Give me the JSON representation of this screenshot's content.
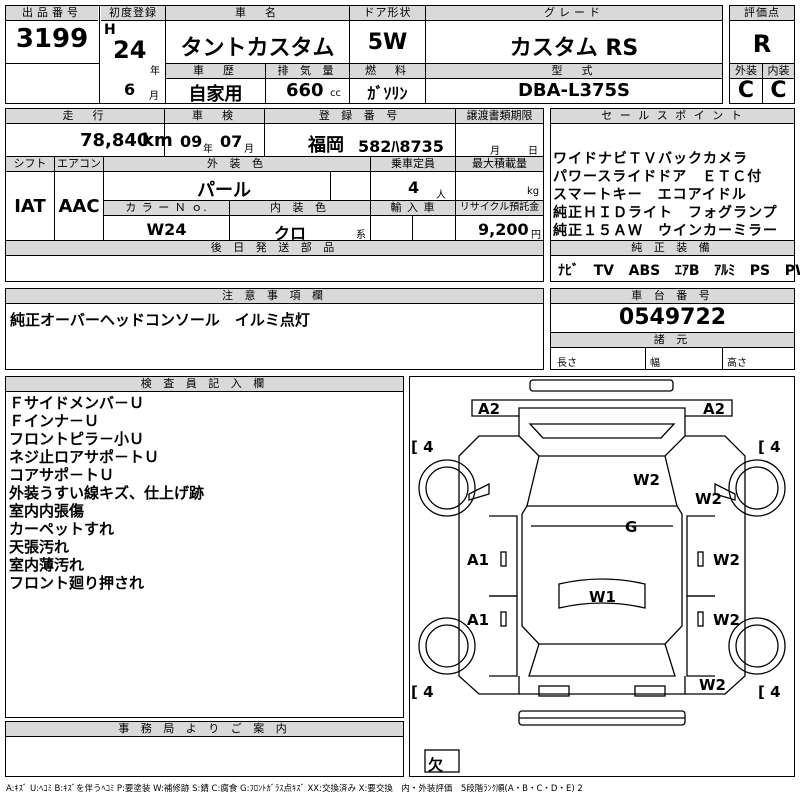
{
  "header": {
    "lot_label": "出品番号",
    "lot_no": "3199",
    "first_reg_label": "初度登録",
    "era": "H",
    "year": "24",
    "year_unit": "年",
    "month": "6",
    "month_unit": "月",
    "name_label": "車　名",
    "car_name": "タントカスタム",
    "door_label": "ドア形状",
    "door": "5W",
    "grade_label": "グレード",
    "grade": "カスタム RS",
    "score_label": "評価点",
    "score": "R",
    "history_label": "車　歴",
    "history": "自家用",
    "displacement_label": "排 気 量",
    "displacement": "660",
    "displacement_unit": "cc",
    "fuel_label": "燃　料",
    "fuel": "ｶﾞｿﾘﾝ",
    "model_label": "型　式",
    "model": "DBA-L375S",
    "ext_label": "外装",
    "ext_grade": "C",
    "int_label": "内装",
    "int_grade": "C"
  },
  "row2": {
    "mileage_label": "走　行",
    "mileage": "78,840",
    "mileage_unit": "km",
    "inspection_label": "車　検",
    "insp_year": "09",
    "insp_year_unit": "年",
    "insp_month": "07",
    "insp_month_unit": "月",
    "plate_label": "登 録 番 号",
    "plate_region": "福岡",
    "plate_no": "582ﾊ8735",
    "transfer_label": "譲渡書類期限",
    "transfer_month": "月",
    "transfer_day": "日",
    "shift_label": "シフト",
    "shift": "IAT",
    "ac_label": "エアコン",
    "ac": "AAC",
    "color_label": "外 装 色",
    "color": "パール",
    "capacity_label": "乗車定員",
    "capacity": "4",
    "capacity_unit": "人",
    "load_label": "最大積載量",
    "load_unit": "kg",
    "color_no_label": "カ ラ ー Ｎ ｏ.",
    "color_no": "W24",
    "interior_label": "内 装 色",
    "interior": "クロ",
    "interior_unit": "系",
    "import_label": "輸 入 車",
    "recycle_label": "リサイクル預託金",
    "recycle": "9,200",
    "recycle_unit": "円",
    "later_label": "後 日 発 送 部 品"
  },
  "sales": {
    "label": "セ ー ル ス ポ イ ン ト",
    "lines": [
      "ワイドナビＴＶバックカメラ",
      "パワースライドドア　ＥＴＣ付",
      "スマートキー　エコアイドル",
      "純正ＨＩＤライト　フォグランプ",
      "純正１５ＡＷ　ウインカーミラー"
    ]
  },
  "equipment": {
    "label": "純 正 装 備",
    "items": [
      "ﾅﾋﾞ",
      "TV",
      "ABS",
      "ｴｱB",
      "ｱﾙﾐ",
      "PS",
      "PW"
    ]
  },
  "notes": {
    "label": "注 意 事 項 欄",
    "text": "純正オーバーヘッドコンソール　イルミ点灯"
  },
  "chassis": {
    "label": "車 台 番 号",
    "number": "0549722",
    "specs_label": "諸 元",
    "length": "長さ",
    "width": "幅",
    "height": "高さ"
  },
  "inspector": {
    "label": "検 査 員 記 入 欄",
    "lines": [
      "Ｆサイドメンバ－Ｕ",
      "Ｆインナ－Ｕ",
      "フロントピラ－小Ｕ",
      "ネジ止ロアサポ－トＵ",
      "コアサポ－トＵ",
      "外装うすい線キズ、仕上げ跡",
      "室内内張傷",
      "カーペットすれ",
      "天張汚れ",
      "室内薄汚れ",
      "フロント廻り押され"
    ]
  },
  "office": {
    "label": "事 務 局 よ り ご 案 内"
  },
  "diagram": {
    "marks": {
      "a2_left": "A2",
      "a2_right": "A2",
      "w2_hood": "W2",
      "w2_front_fender_right": "W2",
      "g_windshield": "G",
      "a1_door_front_left": "A1",
      "w2_door_front_right": "W2",
      "w1_roof": "W1",
      "a1_door_rear_left": "A1",
      "w2_door_rear_right": "W2",
      "w2_rear_right": "W2"
    },
    "tires": {
      "fl": "4",
      "fr": "4",
      "rl": "4",
      "rr": "4"
    },
    "spare": "欠"
  },
  "legend": "A:ｷｽﾞ U:ﾍｺﾐ B:ｷｽﾞを伴うﾍｺﾐ P:要塗装 W:補修跡 S:錆 C:腐食 G:ﾌﾛﾝﾄｶﾞﾗｽ点ｷｽﾞ XX:交換済み X:要交換　内・外装評価　5段階ﾗﾝｸ順(A・B・C・D・E) 2"
}
